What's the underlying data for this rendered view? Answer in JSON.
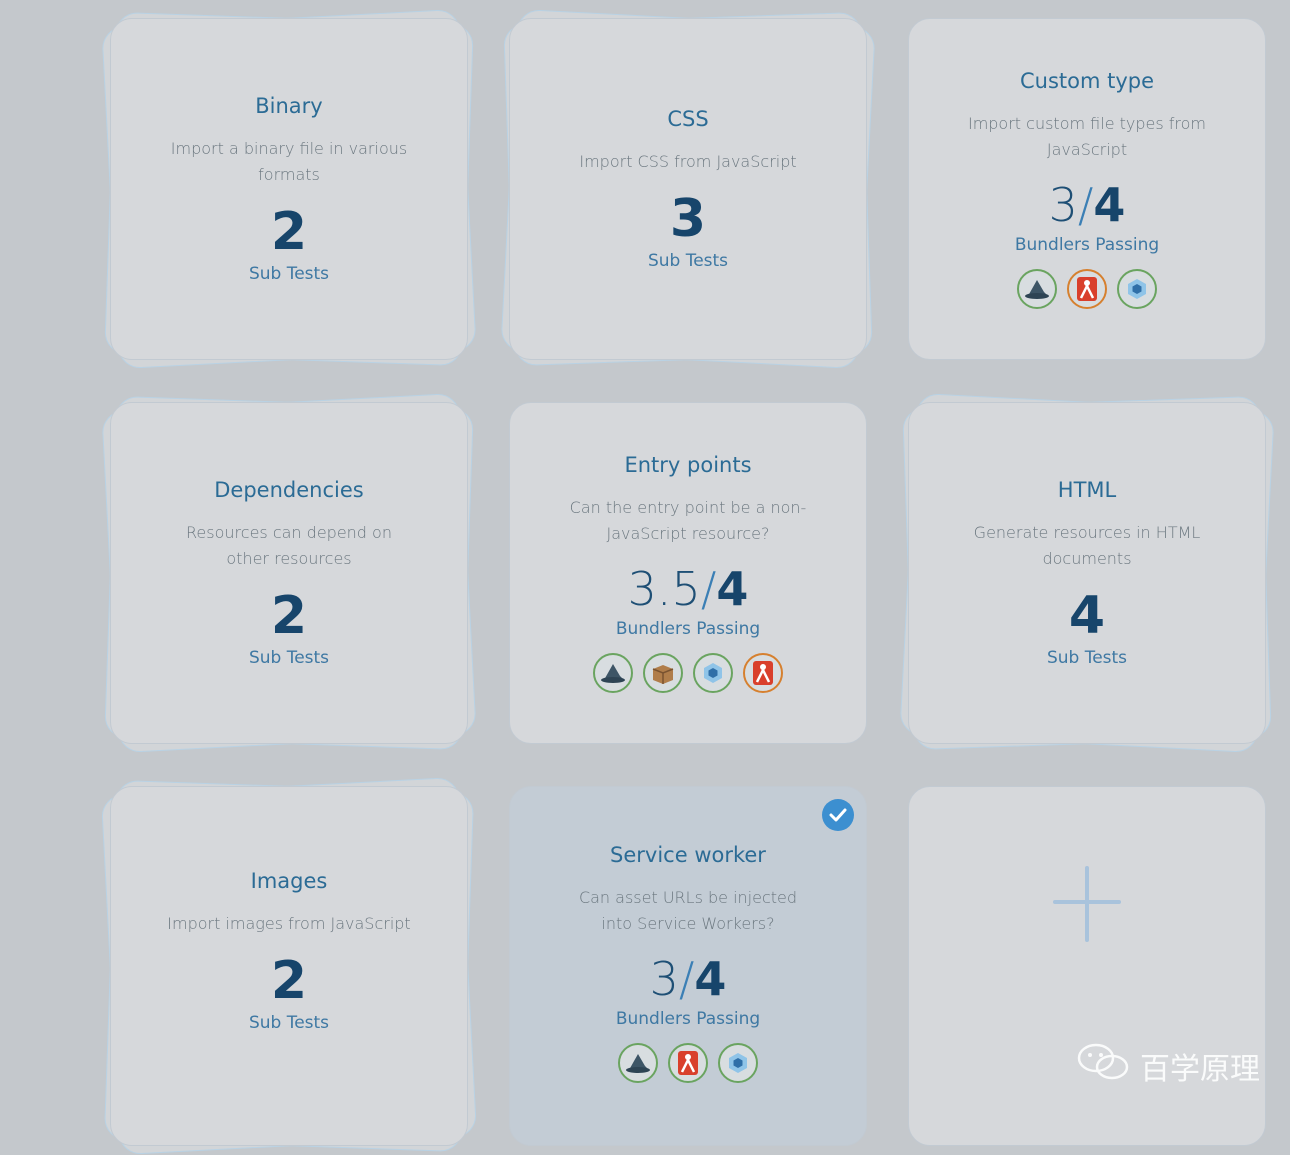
{
  "cards": [
    {
      "title": "Binary",
      "desc": "Import a binary file in various formats",
      "number": "2",
      "label": "Sub Tests"
    },
    {
      "title": "CSS",
      "desc": "Import CSS from JavaScript",
      "number": "3",
      "label": "Sub Tests"
    },
    {
      "title": "Custom type",
      "desc": "Import custom file types from JavaScript",
      "passed": "3",
      "total": "4",
      "label": "Bundlers Passing",
      "bundlers": [
        {
          "name": "browserify-icon",
          "result": "pass"
        },
        {
          "name": "rollup-icon",
          "result": "fail"
        },
        {
          "name": "webpack-icon",
          "result": "pass"
        }
      ]
    },
    {
      "title": "Dependencies",
      "desc": "Resources can depend on other resources",
      "number": "2",
      "label": "Sub Tests"
    },
    {
      "title": "Entry points",
      "desc": "Can the entry point be a non-JavaScript resource?",
      "passed": "3.5",
      "total": "4",
      "label": "Bundlers Passing",
      "bundlers": [
        {
          "name": "browserify-icon",
          "result": "pass"
        },
        {
          "name": "parcel-icon",
          "result": "pass"
        },
        {
          "name": "webpack-icon",
          "result": "pass"
        },
        {
          "name": "rollup-icon",
          "result": "fail"
        }
      ]
    },
    {
      "title": "HTML",
      "desc": "Generate resources in HTML documents",
      "number": "4",
      "label": "Sub Tests"
    },
    {
      "title": "Images",
      "desc": "Import images from JavaScript",
      "number": "2",
      "label": "Sub Tests"
    },
    {
      "title": "Service worker",
      "desc": "Can asset URLs be injected into Service Workers?",
      "passed": "3",
      "total": "4",
      "label": "Bundlers Passing",
      "selected": true,
      "bundlers": [
        {
          "name": "browserify-icon",
          "result": "pass"
        },
        {
          "name": "rollup-icon",
          "result": "pass"
        },
        {
          "name": "webpack-icon",
          "result": "pass"
        }
      ]
    }
  ],
  "add_card": {
    "icon": "plus-icon"
  },
  "watermark": {
    "text": "百学原理",
    "icon": "wechat-icon"
  },
  "colors": {
    "accent": "#2b6b95",
    "pass": "#6aa460",
    "fail": "#d6802f",
    "check": "#3c8fd0"
  }
}
